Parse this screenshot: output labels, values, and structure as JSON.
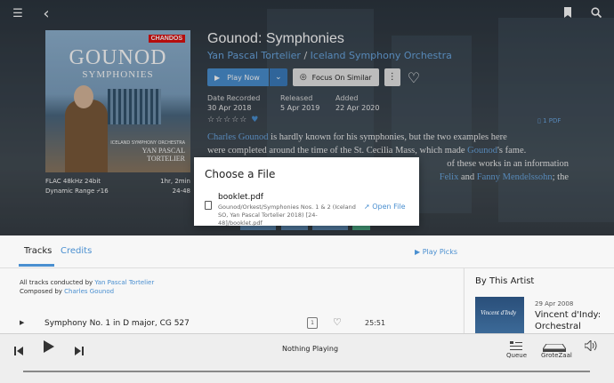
{
  "topbar": {
    "menu_icon": "☰",
    "back_icon": "‹",
    "bookmark_icon": "bookmark",
    "search_icon": "search"
  },
  "album": {
    "cover": {
      "label": "CHANDOS",
      "title": "GOUNOD",
      "subtitle": "SYMPHONIES",
      "orchestra": "ICELAND SYMPHONY ORCHESTRA",
      "conductor_line1": "YAN PASCAL",
      "conductor_line2": "TORTELIER"
    },
    "format": "FLAC 48kHz 24bit",
    "duration": "1hr, 2min",
    "dynamic_range": "Dynamic Range",
    "dr_value": "16",
    "dr_range": "24-48",
    "title": "Gounod: Symphonies",
    "artist1": "Yan Pascal Tortelier",
    "separator": " / ",
    "artist2": "Iceland Symphony Orchestra",
    "play_label": "Play Now",
    "focus_label": "Focus On Similar",
    "date_recorded_label": "Date Recorded",
    "date_recorded": "30 Apr 2018",
    "released_label": "Released",
    "released": "5 Apr 2019",
    "added_label": "Added",
    "added": "22 Apr 2020",
    "stars": "☆☆☆☆☆",
    "pdf_label": "1 PDF",
    "review": {
      "l1_a": "Charles Gounod",
      "l1_b": " is hardly known for his symphonies, but the two examples here",
      "l2_a": "were completed around the time of the St. Cecilia Mass, which made ",
      "l2_b": "Gounod",
      "l2_c": "'s fame.",
      "l3": "of these works in an information",
      "l4_a": "Felix",
      "l4_b": " and ",
      "l4_c": "Fanny Mendelssohn",
      "l4_d": "; the"
    }
  },
  "modal": {
    "title": "Choose a File",
    "filename": "booklet.pdf",
    "path": "Gounod/Orkest/Symphonies Nos. 1 & 2 (Iceland SO, Yan Pascal Tortelier 2018) [24-48]/booklet.pdf",
    "open_label": "Open File"
  },
  "tabs": {
    "tracks": "Tracks",
    "credits": "Credits",
    "play_picks": "Play Picks"
  },
  "credits": {
    "conducted_prefix": "All tracks conducted by ",
    "conductor": "Yan Pascal Tortelier",
    "composed_prefix": "Composed by ",
    "composer": "Charles Gounod"
  },
  "track": {
    "name": "Symphony No. 1 in D major, CG 527",
    "disc": "1",
    "duration": "25:51"
  },
  "by_artist": {
    "heading": "By This Artist",
    "thumb_text": "Vincent d'Indy",
    "date": "29 Apr 2008",
    "title": "Vincent d'Indy: Orchestral Works,"
  },
  "player": {
    "now_playing": "Nothing Playing",
    "queue_label": "Queue",
    "zone_label": "GroteZaal"
  }
}
